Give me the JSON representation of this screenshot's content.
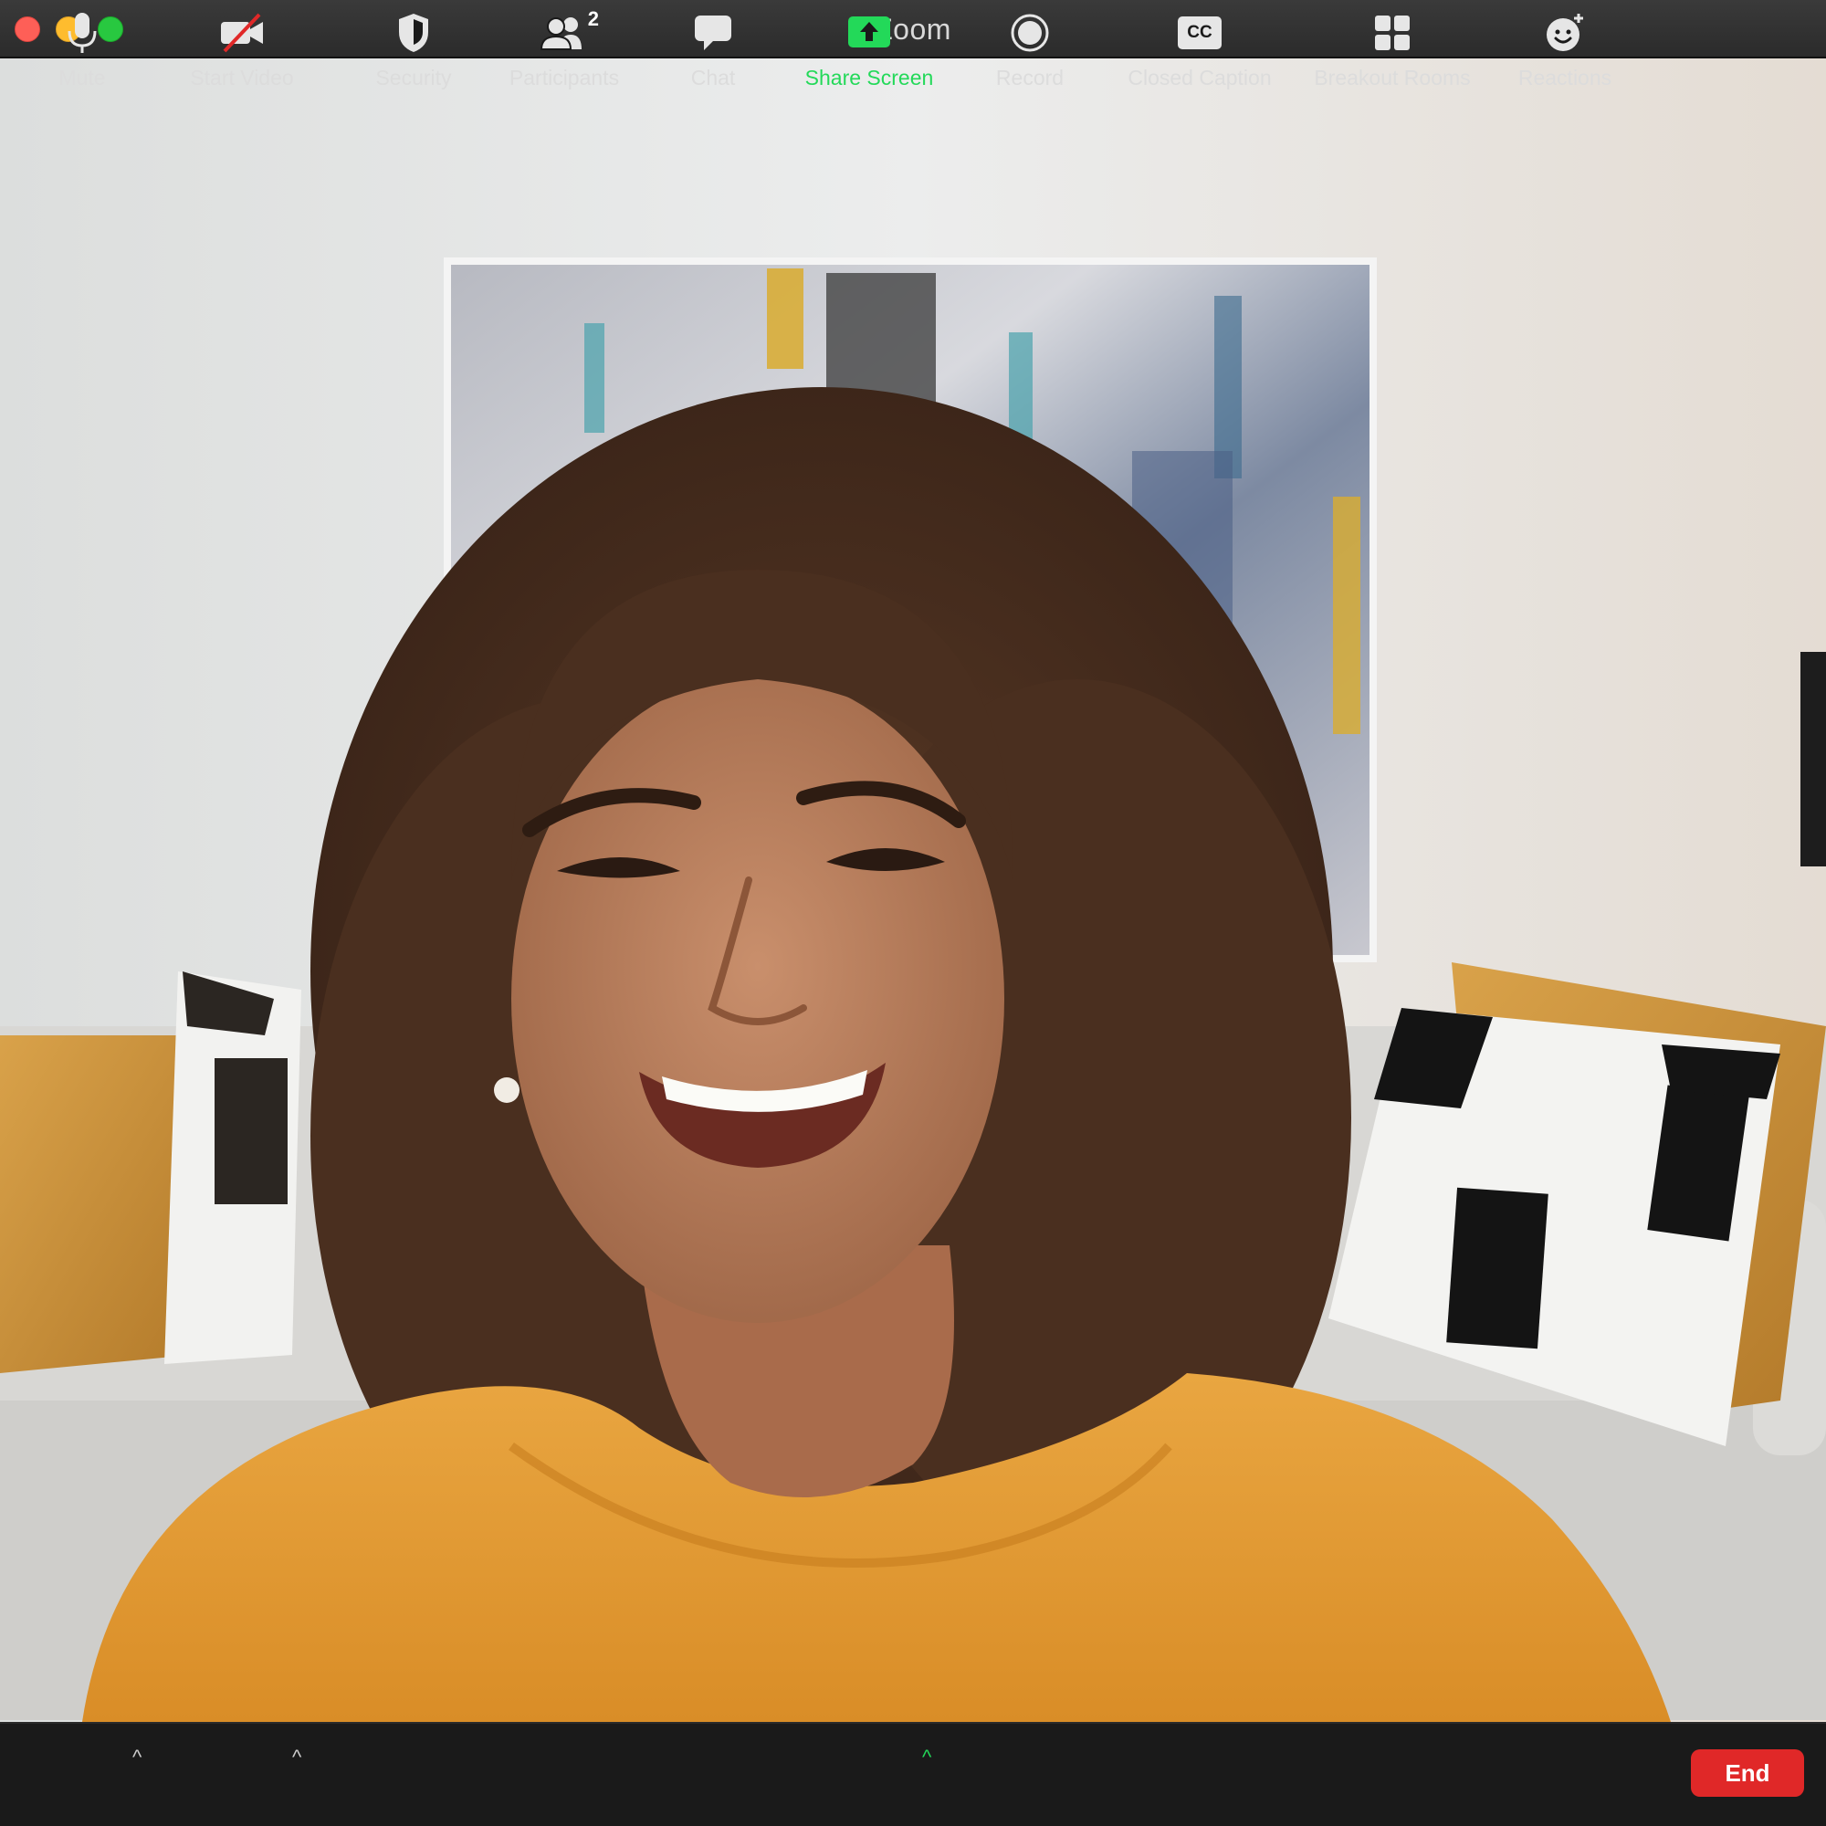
{
  "window": {
    "title": "Zoom"
  },
  "toolbar": {
    "mute": "Mute",
    "start_video": "Start Video",
    "security": "Security",
    "participants": "Participants",
    "participants_count": "2",
    "chat": "Chat",
    "share_screen": "Share Screen",
    "record": "Record",
    "closed_caption": "Closed Caption",
    "cc_glyph": "CC",
    "breakout_rooms": "Breakout Rooms",
    "reactions": "Reactions",
    "end": "End"
  },
  "colors": {
    "share_active": "#23d959",
    "end_button": "#e02828",
    "toolbar_bg": "#1a1a1a",
    "titlebar_bg": "#2b2b2b"
  },
  "icons": [
    "microphone-icon",
    "video-off-icon",
    "shield-icon",
    "participants-icon",
    "chat-bubble-icon",
    "share-screen-icon",
    "record-icon",
    "closed-caption-icon",
    "breakout-rooms-icon",
    "reactions-icon",
    "caret-up-icon"
  ]
}
